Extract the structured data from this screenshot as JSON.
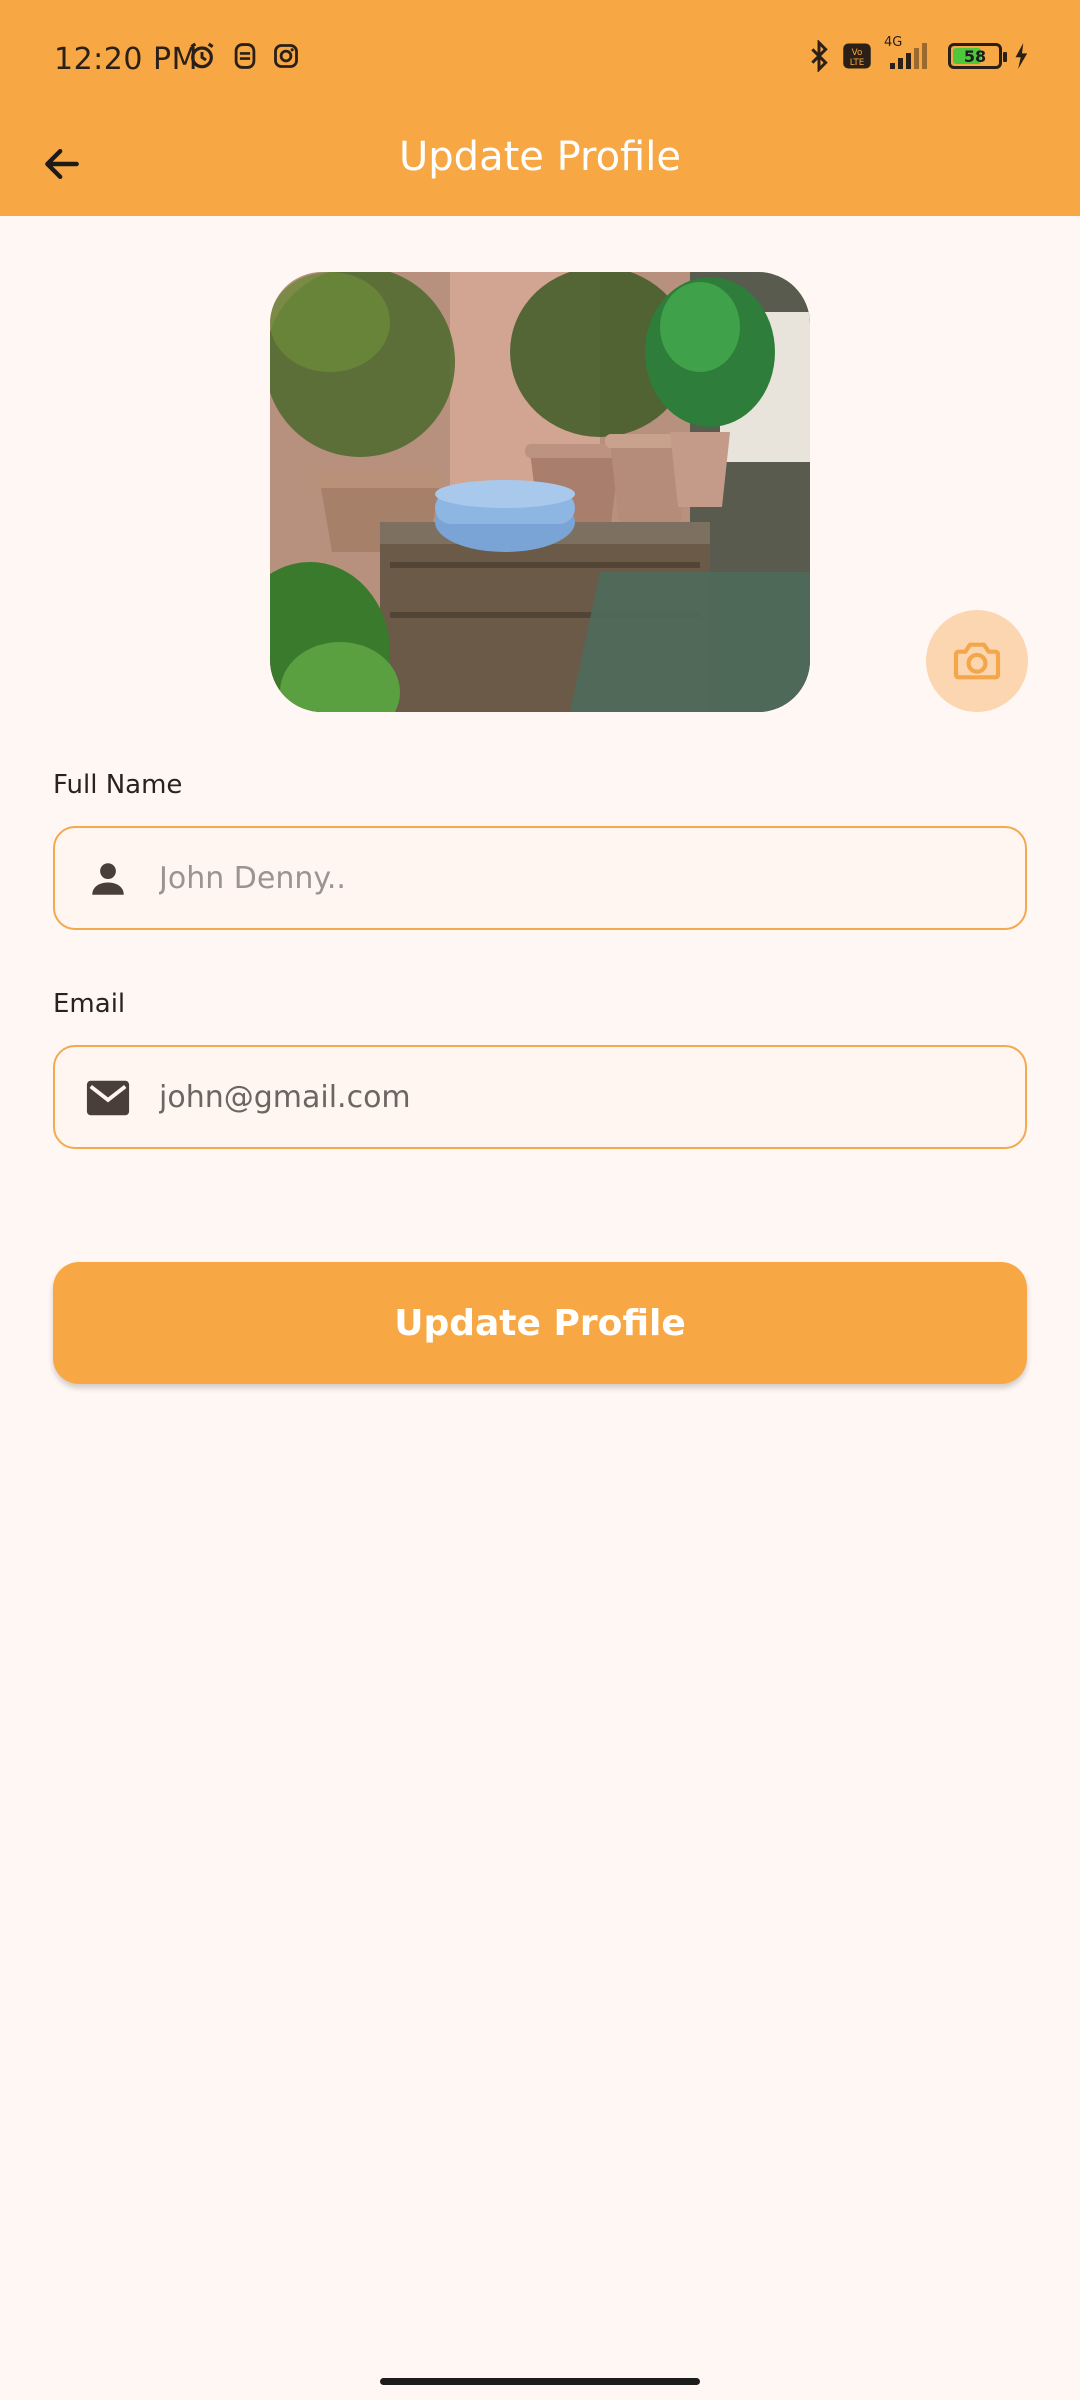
{
  "status_bar": {
    "time": "12:20 PM",
    "battery": "58",
    "network": "4G"
  },
  "app_bar": {
    "title": "Update Profile"
  },
  "form": {
    "full_name_label": "Full Name",
    "full_name_placeholder": "John Denny..",
    "email_label": "Email",
    "email_value": "john@gmail.com",
    "submit_label": "Update Profile"
  },
  "colors": {
    "primary": "#f7a845",
    "background": "#fff7f4",
    "field_border": "#f3a94e",
    "camera_bg": "#fcd6b1"
  }
}
